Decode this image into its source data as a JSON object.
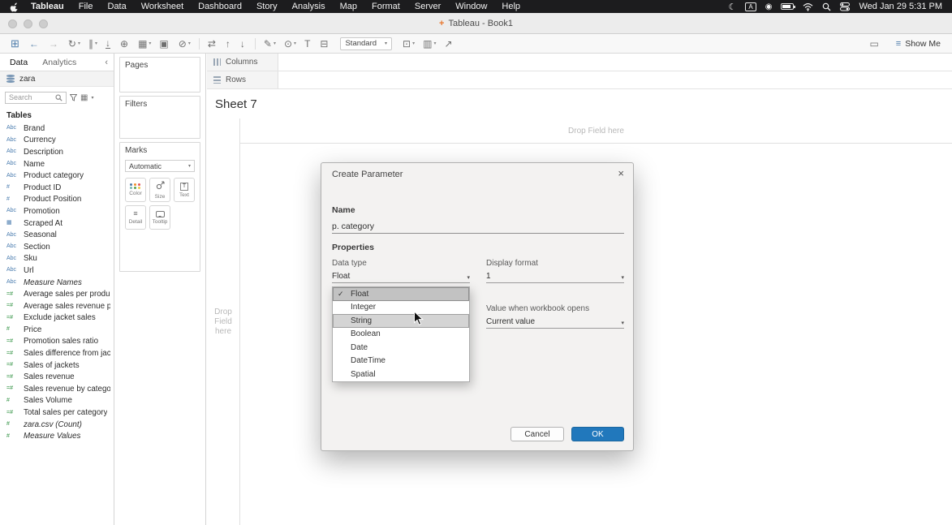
{
  "colors": {
    "accent_blue": "#2178bc",
    "dimension_icon_blue": "#4a7caf",
    "measure_icon_green": "#2f9140",
    "menubar_bg": "#1c1c1e",
    "selected_row_gray": "#c2c2c2",
    "hover_row_gray": "#d4d4d4"
  },
  "menubar": {
    "app_name": "Tableau",
    "items": [
      "File",
      "Data",
      "Worksheet",
      "Dashboard",
      "Story",
      "Analysis",
      "Map",
      "Format",
      "Server",
      "Window",
      "Help"
    ],
    "moon_glyph": "☾",
    "keyboard_badge": "A",
    "record_glyph": "◉",
    "datetime": "Wed Jan 29  5:31 PM"
  },
  "titlebar": {
    "title": "Tableau - Book1",
    "app_icon_glyph": "+"
  },
  "toolbar": {
    "icons_left": [
      {
        "name": "tableau-logo-icon",
        "glyph": "⊞",
        "cls": "logo"
      },
      {
        "name": "undo-icon",
        "glyph": "←",
        "cls": "accent"
      },
      {
        "name": "redo-icon",
        "glyph": "→",
        "cls": "muted"
      },
      {
        "name": "refresh-data-source-icon",
        "glyph": "↻",
        "caret": "▾"
      },
      {
        "name": "pause-auto-updates-icon",
        "glyph": "∥",
        "caret": "▾"
      },
      {
        "name": "save-icon",
        "glyph": "↓",
        "cls": "save"
      },
      {
        "name": "new-data-source-icon",
        "glyph": "⊕"
      },
      {
        "name": "new-worksheet-icon",
        "glyph": "▦",
        "caret": "▾"
      },
      {
        "name": "duplicate-sheet-icon",
        "glyph": "▣"
      },
      {
        "name": "clear-sheet-icon",
        "glyph": "⊘",
        "caret": "▾"
      },
      {
        "name": "toolbar-separator",
        "cls": "sep"
      },
      {
        "name": "swap-rows-columns-icon",
        "glyph": "⇄"
      },
      {
        "name": "sort-ascending-icon",
        "glyph": "↑"
      },
      {
        "name": "sort-descending-icon",
        "glyph": "↓"
      },
      {
        "name": "toolbar-separator",
        "cls": "sep"
      },
      {
        "name": "highlight-icon",
        "glyph": "✎",
        "caret": "▾"
      },
      {
        "name": "group-members-icon",
        "glyph": "⊙",
        "caret": "▾"
      },
      {
        "name": "show-mark-labels-icon",
        "glyph": "T"
      },
      {
        "name": "fix-axes-icon",
        "glyph": "⊟"
      }
    ],
    "view_mode": "Standard",
    "icons_after_select": [
      {
        "name": "fit-selector-icon",
        "glyph": "⊡",
        "caret": "▾"
      },
      {
        "name": "show-hide-cards-icon",
        "glyph": "▥",
        "caret": "▾"
      },
      {
        "name": "share-workbook-icon",
        "glyph": "↗"
      }
    ],
    "icons_right": [
      {
        "name": "device-preview-icon",
        "glyph": "▭"
      }
    ],
    "show_me_label": "Show Me"
  },
  "datapane": {
    "tabs": {
      "data": "Data",
      "analytics": "Analytics"
    },
    "collapse_glyph": "‹",
    "datasource": "zara",
    "search_placeholder": "Search",
    "tables_label": "Tables",
    "fields": [
      {
        "icon": "Abc",
        "icls": "dim",
        "label": "Brand"
      },
      {
        "icon": "Abc",
        "icls": "dim",
        "label": "Currency"
      },
      {
        "icon": "Abc",
        "icls": "dim",
        "label": "Description"
      },
      {
        "icon": "Abc",
        "icls": "dim",
        "label": "Name"
      },
      {
        "icon": "Abc",
        "icls": "dim",
        "label": "Product category"
      },
      {
        "icon": "#",
        "icls": "dim",
        "label": "Product ID"
      },
      {
        "icon": "#",
        "icls": "dim",
        "label": "Product Position"
      },
      {
        "icon": "Abc",
        "icls": "dim",
        "label": "Promotion"
      },
      {
        "icon": "▦",
        "icls": "dim",
        "label": "Scraped At"
      },
      {
        "icon": "Abc",
        "icls": "dim",
        "label": "Seasonal"
      },
      {
        "icon": "Abc",
        "icls": "dim",
        "label": "Section"
      },
      {
        "icon": "Abc",
        "icls": "dim",
        "label": "Sku"
      },
      {
        "icon": "Abc",
        "icls": "dim",
        "label": "Url"
      },
      {
        "icon": "Abc",
        "icls": "dim",
        "label": "Measure Names",
        "lcls": "italic"
      },
      {
        "icon": "=#",
        "icls": "mea",
        "label": "Average sales per product"
      },
      {
        "icon": "=#",
        "icls": "mea",
        "label": "Average sales revenue per..."
      },
      {
        "icon": "=#",
        "icls": "mea",
        "label": "Exclude jacket sales"
      },
      {
        "icon": "#",
        "icls": "mea",
        "label": "Price"
      },
      {
        "icon": "=#",
        "icls": "mea",
        "label": "Promotion sales ratio"
      },
      {
        "icon": "=#",
        "icls": "mea",
        "label": "Sales difference from jack..."
      },
      {
        "icon": "=#",
        "icls": "mea",
        "label": "Sales of jackets"
      },
      {
        "icon": "=#",
        "icls": "mea",
        "label": "Sales revenue"
      },
      {
        "icon": "=#",
        "icls": "mea",
        "label": "Sales revenue by category"
      },
      {
        "icon": "#",
        "icls": "mea",
        "label": "Sales Volume"
      },
      {
        "icon": "=#",
        "icls": "mea",
        "label": "Total sales per category"
      },
      {
        "icon": "#",
        "icls": "mea",
        "label": "zara.csv (Count)",
        "lcls": "italic"
      },
      {
        "icon": "#",
        "icls": "mea",
        "label": "Measure Values",
        "lcls": "italic"
      }
    ]
  },
  "cards": {
    "pages_label": "Pages",
    "filters_label": "Filters",
    "marks": {
      "label": "Marks",
      "type_selector": "Automatic",
      "buttons": {
        "color": "Color",
        "size": "Size",
        "text": "Text",
        "detail": "Detail",
        "tooltip": "Tooltip"
      }
    }
  },
  "shelves": {
    "columns": "Columns",
    "rows": "Rows"
  },
  "sheet": {
    "title": "Sheet 7",
    "drop_hint": "Drop Field here",
    "drop_words": [
      "Drop",
      "Field",
      "here"
    ]
  },
  "dialog": {
    "title": "Create Parameter",
    "close_glyph": "×",
    "name_label": "Name",
    "name_value": "p. category",
    "properties_label": "Properties",
    "data_type_label": "Data type",
    "data_type_value": "Float",
    "display_format_label": "Display format",
    "display_format_value": "1",
    "value_when_label": "Value when workbook opens",
    "value_when_value": "Current value",
    "type_options": [
      {
        "label": "Float",
        "check": "✓",
        "cls": "selected"
      },
      {
        "label": "Integer"
      },
      {
        "label": "String",
        "cls": "hover"
      },
      {
        "label": "Boolean"
      },
      {
        "label": "Date"
      },
      {
        "label": "DateTime"
      },
      {
        "label": "Spatial"
      }
    ],
    "cancel_label": "Cancel",
    "ok_label": "OK"
  }
}
